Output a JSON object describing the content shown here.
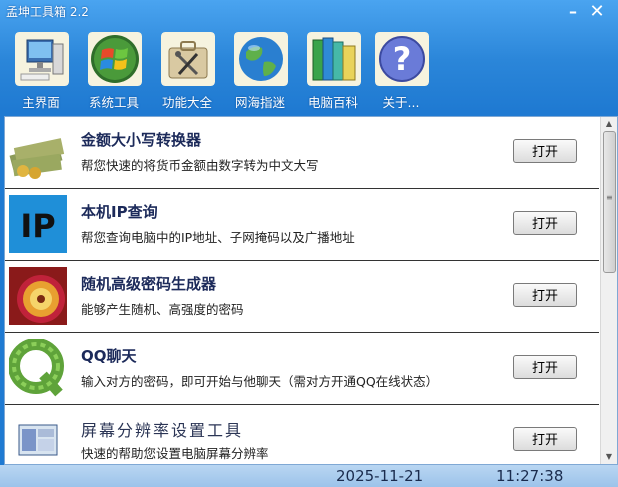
{
  "window": {
    "title": "孟坤工具箱 2.2",
    "minimize": "–",
    "close": "✕"
  },
  "toolbar": [
    {
      "label": "主界面",
      "icon": "computer-icon"
    },
    {
      "label": "系统工具",
      "icon": "windows-logo-icon"
    },
    {
      "label": "功能大全",
      "icon": "toolbox-icon"
    },
    {
      "label": "网海指迷",
      "icon": "globe-icon"
    },
    {
      "label": "电脑百科",
      "icon": "books-icon"
    },
    {
      "label": "关于...",
      "icon": "question-icon"
    }
  ],
  "items": [
    {
      "title": "金额大小写转换器",
      "desc": "帮您快速的将货币金额由数字转为中文大写",
      "button": "打开",
      "icon": "money-icon"
    },
    {
      "title": "本机IP查询",
      "desc": "帮您查询电脑中的IP地址、子网掩码以及广播地址",
      "button": "打开",
      "icon": "ip-icon"
    },
    {
      "title": "随机高级密码生成器",
      "desc": "能够产生随机、高强度的密码",
      "button": "打开",
      "icon": "safe-dial-icon"
    },
    {
      "title": "QQ聊天",
      "desc": "输入对方的密码，即可开始与他聊天（需对方开通QQ在线状态）",
      "button": "打开",
      "icon": "leaf-q-icon"
    },
    {
      "title": "屏幕分辨率设置工具",
      "desc": "快速的帮助您设置电脑屏幕分辨率",
      "button": "打开",
      "icon": "screen-settings-icon"
    }
  ],
  "status": {
    "date": "2025-11-21",
    "time": "11:27:38"
  },
  "colors": {
    "titlebar": "#4aa4f0",
    "statusbar": "#b9d6f2"
  }
}
